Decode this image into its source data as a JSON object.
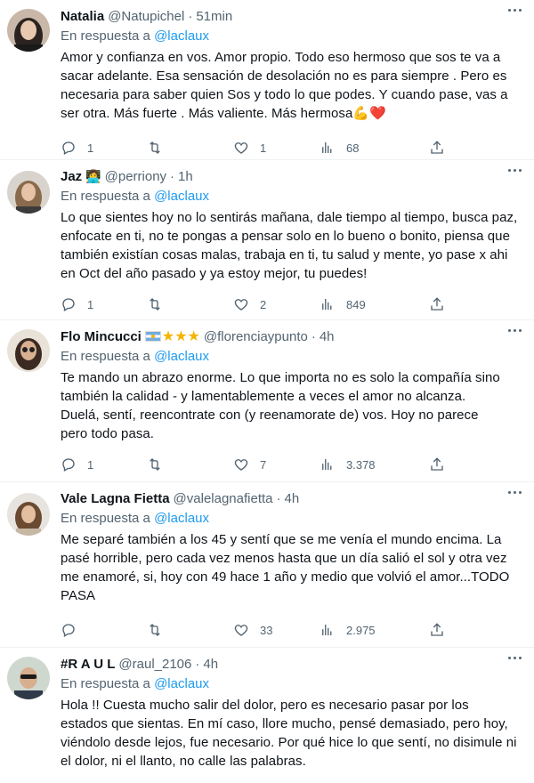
{
  "tweets": [
    {
      "name": "Natalia",
      "badge": "",
      "handle": "@Natupichel",
      "time": "51min",
      "reply_prefix": "En respuesta a",
      "reply_to": "@laclaux",
      "text": "Amor y confianza en vos. Amor propio. Todo eso hermoso que sos te va a sacar adelante. Esa sensación de desolación no es para siempre . Pero es necesaria para saber quien Sos y todo lo  que podes. Y cuando pase, vas a ser otra. Más fuerte . Más valiente. Más hermosa💪❤️",
      "replies": "1",
      "retweets": "",
      "likes": "1",
      "views": "68"
    },
    {
      "name": "Jaz",
      "badge": "👩‍💻",
      "handle": "@perriony",
      "time": "1h",
      "reply_prefix": "En respuesta a",
      "reply_to": "@laclaux",
      "text": "Lo que sientes hoy no lo sentirás mañana, dale tiempo al tiempo, busca paz, enfocate en ti, no te pongas a pensar solo en lo bueno o bonito, piensa que también existían cosas malas, trabaja en ti, tu salud y mente, yo pase x ahi en Oct del año pasado y ya estoy mejor, tu puedes!",
      "replies": "1",
      "retweets": "",
      "likes": "2",
      "views": "849"
    },
    {
      "name": "Flo Mincucci",
      "badge": "★★★",
      "handle": "@florenciaypunto",
      "time": "4h",
      "reply_prefix": "En respuesta a",
      "reply_to": "@laclaux",
      "text": "Te mando un abrazo enorme. Lo que importa no es solo la compañía sino también la calidad - y lamentablemente a veces el amor no alcanza. Duelá, sentí, reencontrate con (y reenamorate de) vos. Hoy no parece pero todo pasa.",
      "replies": "1",
      "retweets": "",
      "likes": "7",
      "views": "3.378"
    },
    {
      "name": "Vale Lagna Fietta",
      "badge": "",
      "handle": "@valelagnafietta",
      "time": "4h",
      "reply_prefix": "En respuesta a",
      "reply_to": "@laclaux",
      "text": "Me separé también a los 45 y sentí que se me venía el mundo encima. La pasé horrible, pero cada vez menos hasta que un día salió el sol y otra vez me enamoré, si, hoy con 49 hace 1 año y medio que volvió el amor...TODO PASA",
      "replies": "",
      "retweets": "",
      "likes": "33",
      "views": "2.975"
    },
    {
      "name": "#R A U L",
      "badge": "",
      "handle": "@raul_2106",
      "time": "4h",
      "reply_prefix": "En respuesta a",
      "reply_to": "@laclaux",
      "text": "Hola !! Cuesta mucho salir del dolor, pero es necesario pasar por los estados que sientas. En mí caso, llore mucho, pensé demasiado, pero hoy, viéndolo desde lejos, fue necesario. Por qué hice lo que sentí, no disimule ni el dolor, ni el llanto, no calle las palabras.",
      "replies": "",
      "retweets": "",
      "likes": "",
      "views": ""
    }
  ]
}
